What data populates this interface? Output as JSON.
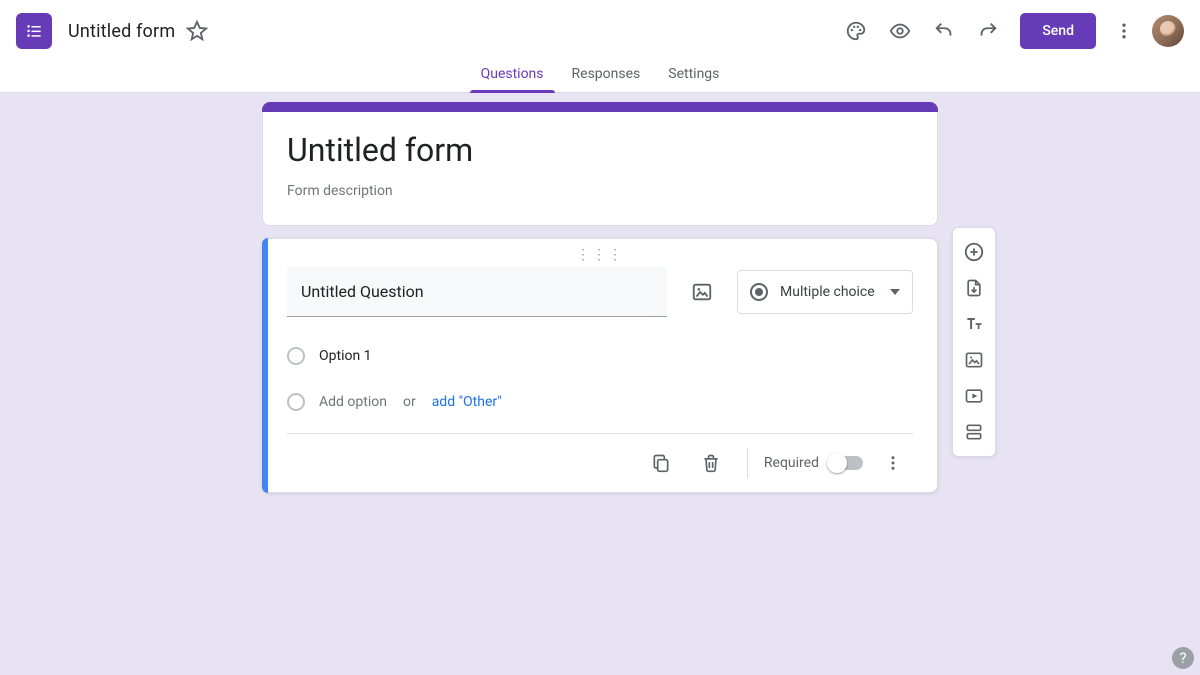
{
  "header": {
    "doc_title": "Untitled form",
    "send_label": "Send"
  },
  "tabs": {
    "questions": "Questions",
    "responses": "Responses",
    "settings": "Settings"
  },
  "form": {
    "title": "Untitled form",
    "description_placeholder": "Form description"
  },
  "question": {
    "title_value": "Untitled Question",
    "type_label": "Multiple choice",
    "option1": "Option 1",
    "add_option": "Add option",
    "or": "or",
    "add_other": "add \"Other\"",
    "required_label": "Required"
  },
  "icons": {
    "palette": "palette-icon",
    "preview": "eye-icon",
    "undo": "undo-icon",
    "redo": "redo-icon",
    "more": "more-vert-icon",
    "star": "star-outline-icon",
    "image": "image-icon",
    "copy": "copy-icon",
    "delete": "trash-icon",
    "add_question": "plus-circle-icon",
    "import": "import-icon",
    "add_title": "text-icon",
    "add_image": "image-icon",
    "add_video": "video-icon",
    "add_section": "section-icon",
    "help": "help-icon"
  }
}
